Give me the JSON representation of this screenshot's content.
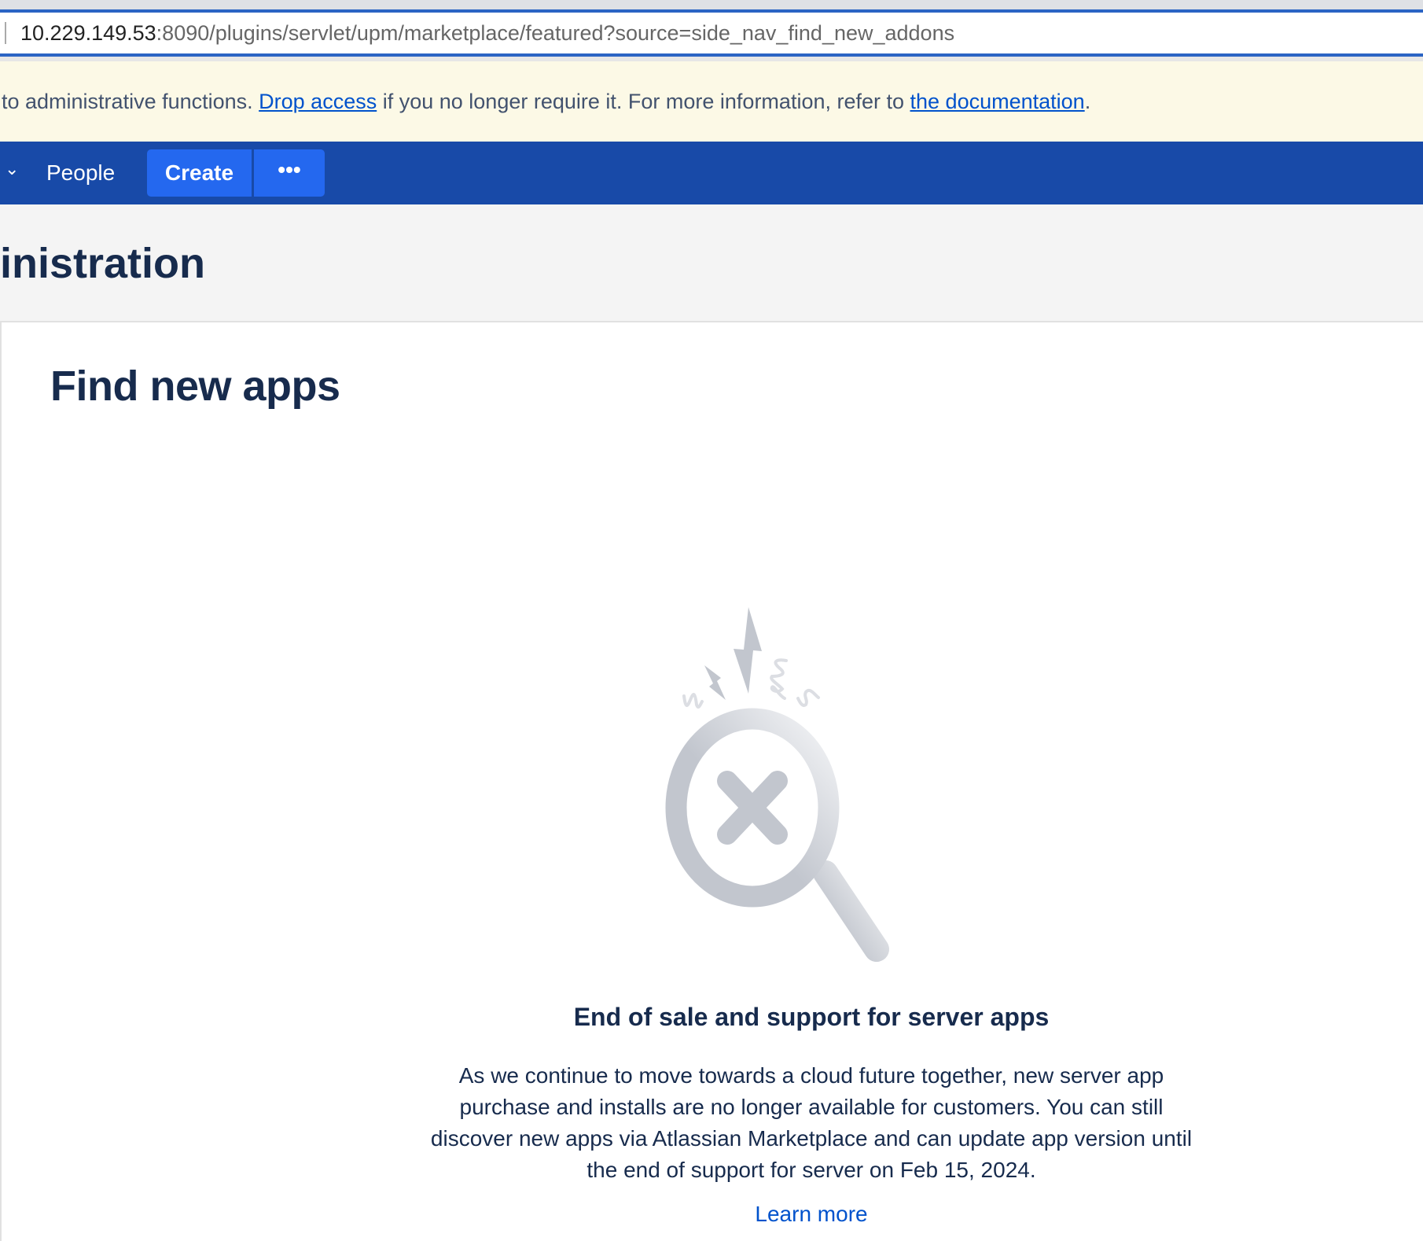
{
  "browser": {
    "url_host": "10.229.149.53",
    "url_rest": ":8090/plugins/servlet/upm/marketplace/featured?source=side_nav_find_new_addons"
  },
  "banner": {
    "text_before": "to administrative functions. ",
    "drop_access": "Drop access",
    "text_middle": " if you no longer require it. For more information, refer to ",
    "documentation": "the documentation",
    "text_after": "."
  },
  "nav": {
    "chevron": "⌄",
    "people": "People",
    "create": "Create",
    "more": "•••"
  },
  "page": {
    "title": "inistration"
  },
  "main": {
    "heading": "Find new apps",
    "empty_state": {
      "title": "End of sale and support for server apps",
      "body": "As we continue to move towards a cloud future together, new server app purchase and installs are no longer available for customers. You can still discover new apps via Atlassian Marketplace and can update app version until the end of support for server on Feb 15, 2024.",
      "link": "Learn more"
    }
  }
}
